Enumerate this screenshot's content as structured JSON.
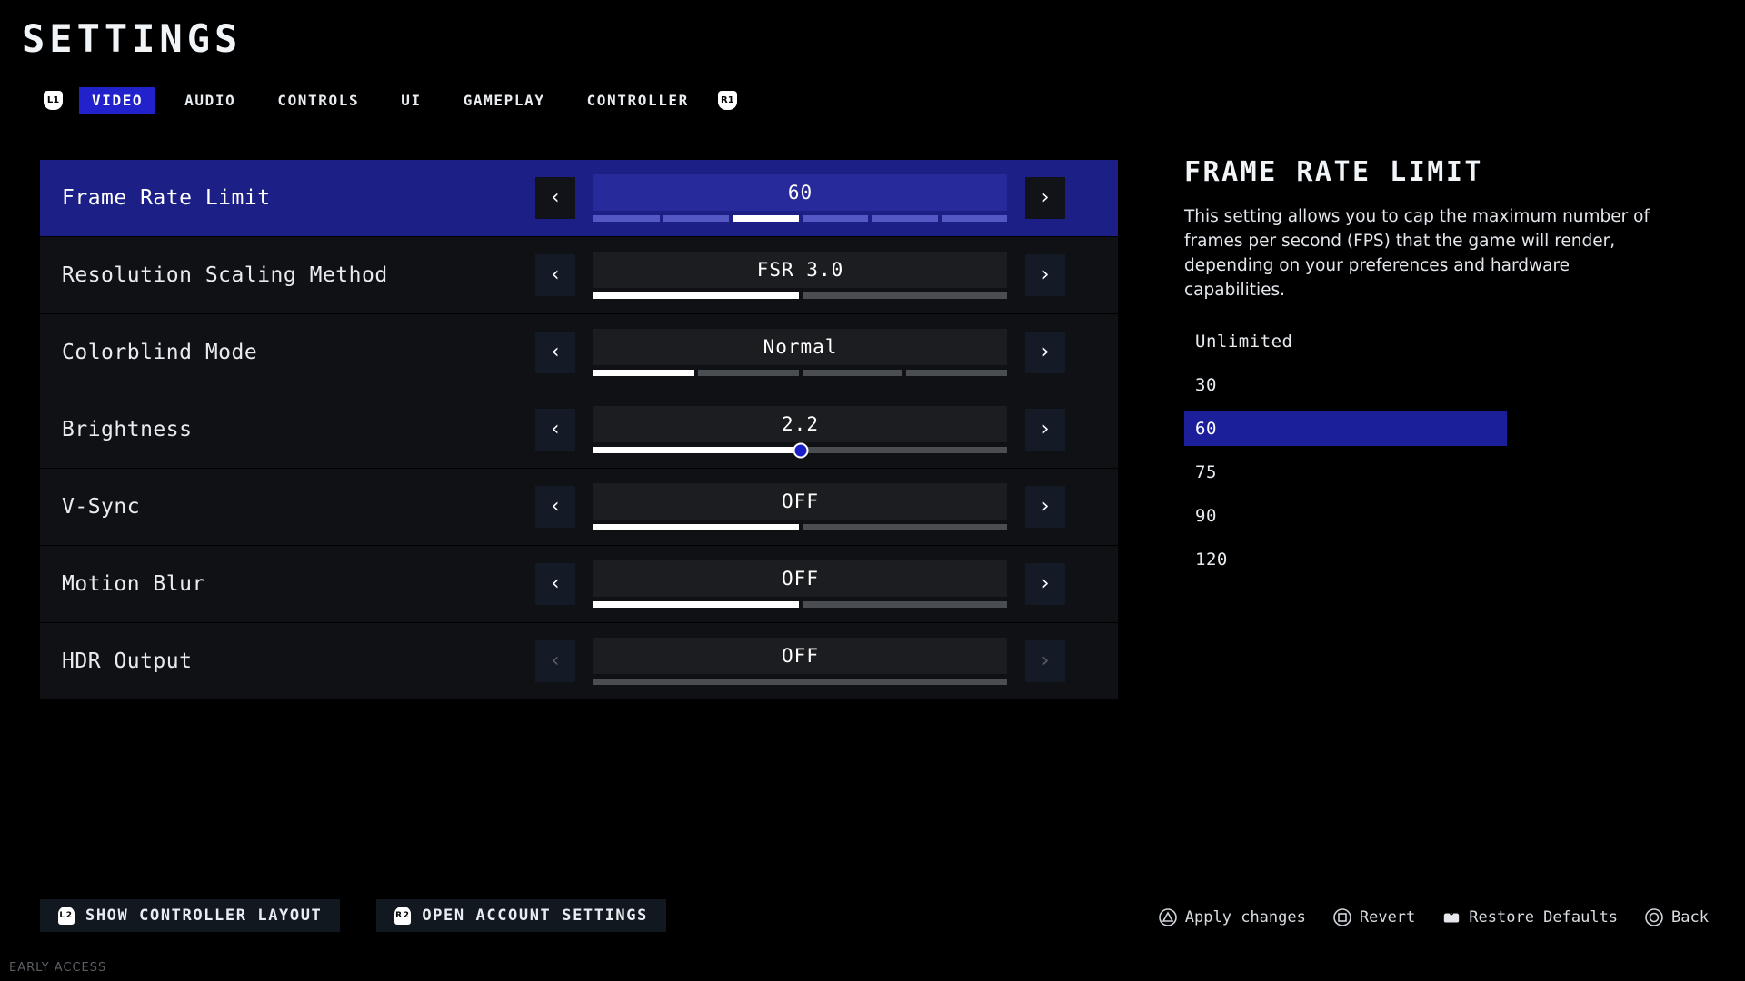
{
  "header": {
    "title": "SETTINGS"
  },
  "tabbar": {
    "left_bumper": "L1",
    "right_bumper": "R1",
    "tabs": [
      {
        "label": "VIDEO",
        "active": true
      },
      {
        "label": "AUDIO",
        "active": false
      },
      {
        "label": "CONTROLS",
        "active": false
      },
      {
        "label": "UI",
        "active": false
      },
      {
        "label": "GAMEPLAY",
        "active": false
      },
      {
        "label": "CONTROLLER",
        "active": false
      }
    ]
  },
  "settings": {
    "rows": [
      {
        "label": "Frame Rate Limit",
        "value": "60",
        "selected": true,
        "disabled": false,
        "control": "segments",
        "segments": 6,
        "active_segment": 3,
        "left_arrow": "‹",
        "right_arrow": "›"
      },
      {
        "label": "Resolution Scaling Method",
        "value": "FSR 3.0",
        "selected": false,
        "disabled": false,
        "control": "segments",
        "segments": 2,
        "active_segment": 1,
        "left_arrow": "‹",
        "right_arrow": "›"
      },
      {
        "label": "Colorblind Mode",
        "value": "Normal",
        "selected": false,
        "disabled": false,
        "control": "segments",
        "segments": 4,
        "active_segment": 1,
        "left_arrow": "‹",
        "right_arrow": "›"
      },
      {
        "label": "Brightness",
        "value": "2.2",
        "selected": false,
        "disabled": false,
        "control": "slider",
        "slider_percent": 50,
        "left_arrow": "‹",
        "right_arrow": "›"
      },
      {
        "label": "V-Sync",
        "value": "OFF",
        "selected": false,
        "disabled": false,
        "control": "segments",
        "segments": 2,
        "active_segment": 1,
        "left_arrow": "‹",
        "right_arrow": "›"
      },
      {
        "label": "Motion Blur",
        "value": "OFF",
        "selected": false,
        "disabled": false,
        "control": "segments",
        "segments": 2,
        "active_segment": 1,
        "left_arrow": "‹",
        "right_arrow": "›"
      },
      {
        "label": "HDR Output",
        "value": "OFF",
        "selected": false,
        "disabled": true,
        "control": "flat",
        "left_arrow": "‹",
        "right_arrow": "›"
      }
    ]
  },
  "info_panel": {
    "title": "FRAME RATE LIMIT",
    "description": "This setting allows you to cap the maximum number of frames per second (FPS) that the game will render, depending on your preferences and hardware capabilities.",
    "options": [
      {
        "label": "Unlimited",
        "selected": false
      },
      {
        "label": "30",
        "selected": false
      },
      {
        "label": "60",
        "selected": true
      },
      {
        "label": "75",
        "selected": false
      },
      {
        "label": "90",
        "selected": false
      },
      {
        "label": "120",
        "selected": false
      }
    ]
  },
  "bottom_bar": {
    "left_buttons": [
      {
        "trigger": "L2",
        "label": "SHOW CONTROLLER LAYOUT"
      },
      {
        "trigger": "R2",
        "label": "OPEN ACCOUNT SETTINGS"
      }
    ],
    "prompts": [
      {
        "glyph": "triangle-icon",
        "label": "Apply changes"
      },
      {
        "glyph": "square-icon",
        "label": "Revert"
      },
      {
        "glyph": "touchpad-icon",
        "label": "Restore Defaults"
      },
      {
        "glyph": "circle-icon",
        "label": "Back"
      }
    ]
  },
  "footer": {
    "note": "EARLY ACCESS"
  },
  "colors": {
    "background": "#000000",
    "accent_blue": "#1b1f86",
    "tab_active": "#2222cc",
    "row_background": "#101114",
    "segment_off": "#4a4d52",
    "segment_on": "#ffffff",
    "knob": "#1b1fc8"
  }
}
